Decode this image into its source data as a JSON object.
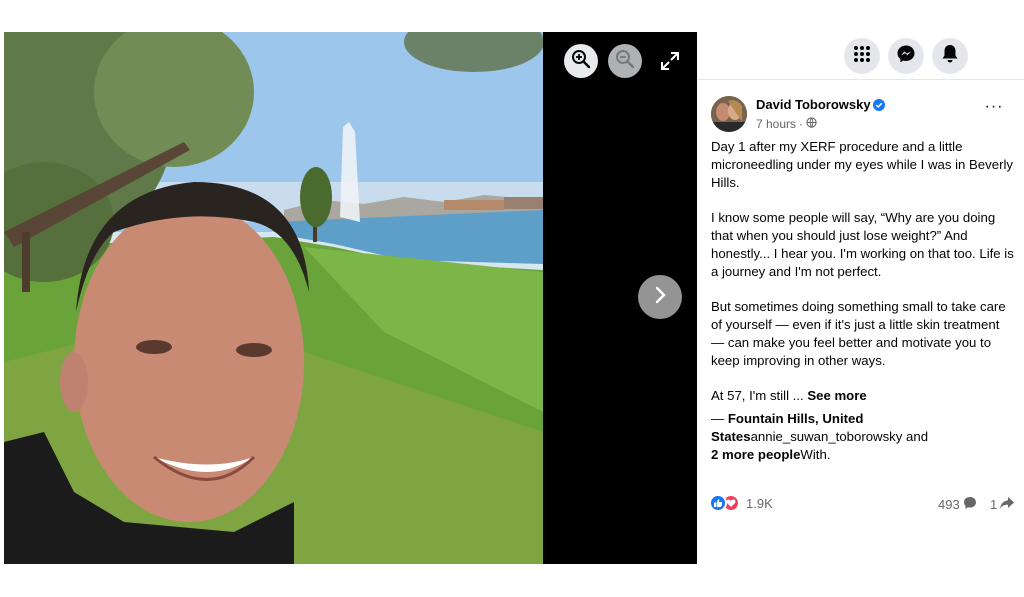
{
  "viewer": {
    "zoom_in_icon": "zoom-in-icon",
    "zoom_out_icon": "zoom-out-icon",
    "fullscreen_icon": "expand-icon",
    "next_icon": "chevron-right-icon"
  },
  "topbar": {
    "icons": [
      "grid-menu-icon",
      "messenger-icon",
      "bell-icon"
    ]
  },
  "post": {
    "author": "David Toborowsky",
    "verified_color": "#1877f2",
    "time": "7 hours",
    "separator": "·",
    "more": "···",
    "caption": [
      "Day 1 after my XERF procedure and a little microneedling under my eyes while I was in Beverly Hills.",
      "I know some people will say, “Why are you doing that when you should just lose weight?” And honestly... I hear you. I'm working on that too. Life is a journey and I'm not perfect.",
      "But sometimes doing something small to take care of yourself — even if it's just a little skin treatment — can make you feel better and motivate you to keep improving in other ways."
    ],
    "truncated": "At 57, I'm still ...",
    "see_more": "See more",
    "location_prefix": "— ",
    "location": "Fountain Hills, United States",
    "tagged_user": "annie_suwan_toborowsky",
    "tag_joiner": " and",
    "more_people": "2 more people",
    "with_label": "With.",
    "reaction_count": "1.9K",
    "comment_count": "493",
    "share_count": "1"
  }
}
